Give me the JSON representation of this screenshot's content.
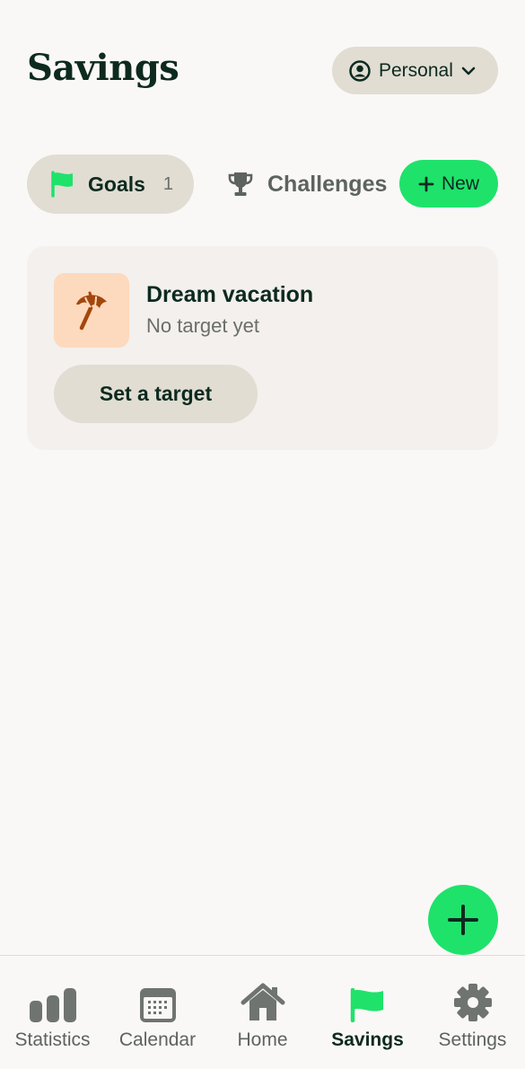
{
  "header": {
    "title": "Savings",
    "account_label": "Personal"
  },
  "tabs": {
    "goals_label": "Goals",
    "goals_count": "1",
    "challenges_label": "Challenges",
    "new_label": "New"
  },
  "goal_card": {
    "name": "Dream vacation",
    "status": "No target yet",
    "action_label": "Set a target",
    "icon": "beach-umbrella-icon"
  },
  "tabbar": {
    "items": [
      {
        "label": "Statistics",
        "icon": "bar-chart-icon"
      },
      {
        "label": "Calendar",
        "icon": "calendar-icon"
      },
      {
        "label": "Home",
        "icon": "home-icon"
      },
      {
        "label": "Savings",
        "icon": "flag-icon"
      },
      {
        "label": "Settings",
        "icon": "gear-icon"
      }
    ],
    "active": "Savings"
  },
  "colors": {
    "accent": "#1fe26b",
    "text": "#0d2a1f",
    "pill": "#e1ddd3",
    "card": "#f3f0ed",
    "goal_tile": "#fdd9bd",
    "goal_icon": "#a3470c"
  }
}
